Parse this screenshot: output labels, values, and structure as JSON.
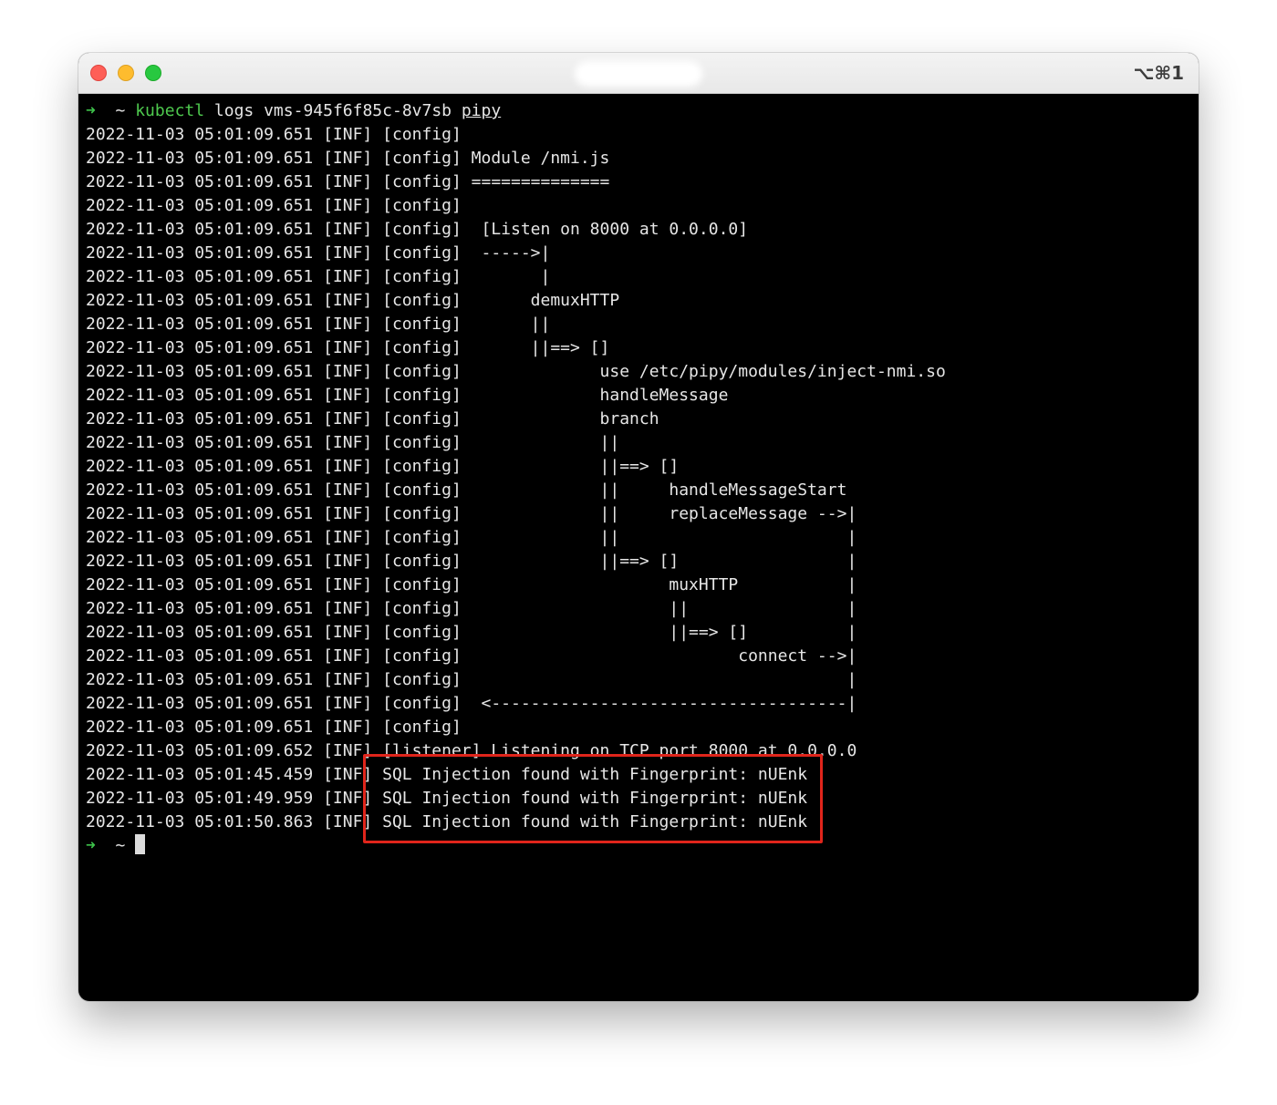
{
  "window": {
    "shortcut": "⌥⌘1"
  },
  "prompt": {
    "arrow": "➜",
    "dir": "~",
    "cmd": "kubectl",
    "args": " logs vms-945f6f85c-8v7sb ",
    "last_arg": "pipy"
  },
  "log_lines": [
    "2022-11-03 05:01:09.651 [INF] [config]",
    "2022-11-03 05:01:09.651 [INF] [config] Module /nmi.js",
    "2022-11-03 05:01:09.651 [INF] [config] ==============",
    "2022-11-03 05:01:09.651 [INF] [config]",
    "2022-11-03 05:01:09.651 [INF] [config]  [Listen on 8000 at 0.0.0.0]",
    "2022-11-03 05:01:09.651 [INF] [config]  ----->|",
    "2022-11-03 05:01:09.651 [INF] [config]        |",
    "2022-11-03 05:01:09.651 [INF] [config]       demuxHTTP",
    "2022-11-03 05:01:09.651 [INF] [config]       ||",
    "2022-11-03 05:01:09.651 [INF] [config]       ||==> []",
    "2022-11-03 05:01:09.651 [INF] [config]              use /etc/pipy/modules/inject-nmi.so",
    "2022-11-03 05:01:09.651 [INF] [config]              handleMessage",
    "2022-11-03 05:01:09.651 [INF] [config]              branch",
    "2022-11-03 05:01:09.651 [INF] [config]              ||",
    "2022-11-03 05:01:09.651 [INF] [config]              ||==> []",
    "2022-11-03 05:01:09.651 [INF] [config]              ||     handleMessageStart",
    "2022-11-03 05:01:09.651 [INF] [config]              ||     replaceMessage -->|",
    "2022-11-03 05:01:09.651 [INF] [config]              ||                       |",
    "2022-11-03 05:01:09.651 [INF] [config]              ||==> []                 |",
    "2022-11-03 05:01:09.651 [INF] [config]                     muxHTTP           |",
    "2022-11-03 05:01:09.651 [INF] [config]                     ||                |",
    "2022-11-03 05:01:09.651 [INF] [config]                     ||==> []          |",
    "2022-11-03 05:01:09.651 [INF] [config]                            connect -->|",
    "2022-11-03 05:01:09.651 [INF] [config]                                       |",
    "2022-11-03 05:01:09.651 [INF] [config]  <------------------------------------|",
    "2022-11-03 05:01:09.651 [INF] [config]",
    "2022-11-03 05:01:09.652 [INF] [listener] Listening on TCP port 8000 at 0.0.0.0",
    "2022-11-03 05:01:45.459 [INF] SQL Injection found with Fingerprint: nUEnk",
    "2022-11-03 05:01:49.959 [INF] SQL Injection found with Fingerprint: nUEnk",
    "2022-11-03 05:01:50.863 [INF] SQL Injection found with Fingerprint: nUEnk"
  ],
  "colors": {
    "annotation": "#e0251b",
    "prompt_arrow": "#3ec24b"
  }
}
